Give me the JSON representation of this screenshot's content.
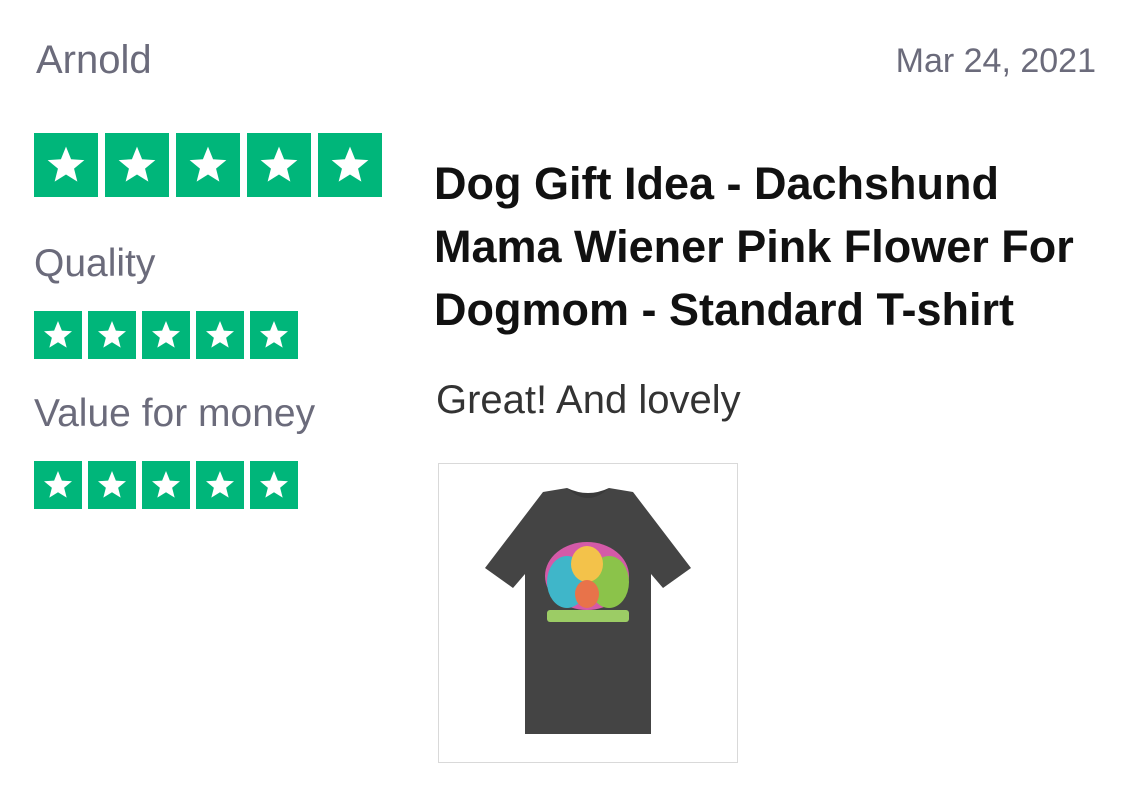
{
  "review": {
    "reviewer": "Arnold",
    "date": "Mar 24, 2021",
    "overall_rating": 5,
    "title": "Dog Gift Idea - Dachshund Mama  Wiener Pink Flower For  Dogmom - Standard T-shirt",
    "body": "Great! And lovely",
    "sub_ratings": [
      {
        "label": "Quality",
        "rating": 5
      },
      {
        "label": "Value for money",
        "rating": 5
      }
    ],
    "photo": {
      "icon": "tshirt-photo"
    }
  },
  "colors": {
    "star_green": "#00b67a",
    "muted_text": "#6b6b7b",
    "title_text": "#111111",
    "shirt": "#444444"
  }
}
